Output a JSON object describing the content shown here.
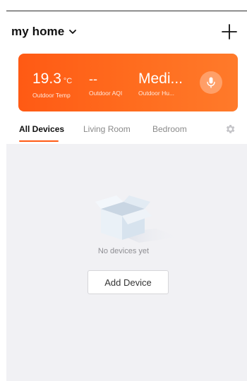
{
  "header": {
    "title": "my home",
    "chevron_icon": "chevron-down-icon",
    "add_icon": "plus-icon"
  },
  "weather": {
    "temperature": {
      "value": "19.3",
      "unit": "°C",
      "label": "Outdoor Temp"
    },
    "aqi": {
      "value": "--",
      "label": "Outdoor AQI"
    },
    "humidity": {
      "value": "Medi...",
      "label": "Outdoor Hu..."
    },
    "mic_icon": "microphone-icon",
    "card_color": "#ff5a14"
  },
  "tabs": [
    {
      "label": "All Devices",
      "active": true
    },
    {
      "label": "Living Room",
      "active": false
    },
    {
      "label": "Bedroom",
      "active": false
    }
  ],
  "settings_icon": "gear-icon",
  "empty_state": {
    "illustration": "empty-box-icon",
    "message": "No devices yet",
    "button_label": "Add Device"
  },
  "colors": {
    "accent": "#ff5a14",
    "background": "#f1f1f4"
  }
}
